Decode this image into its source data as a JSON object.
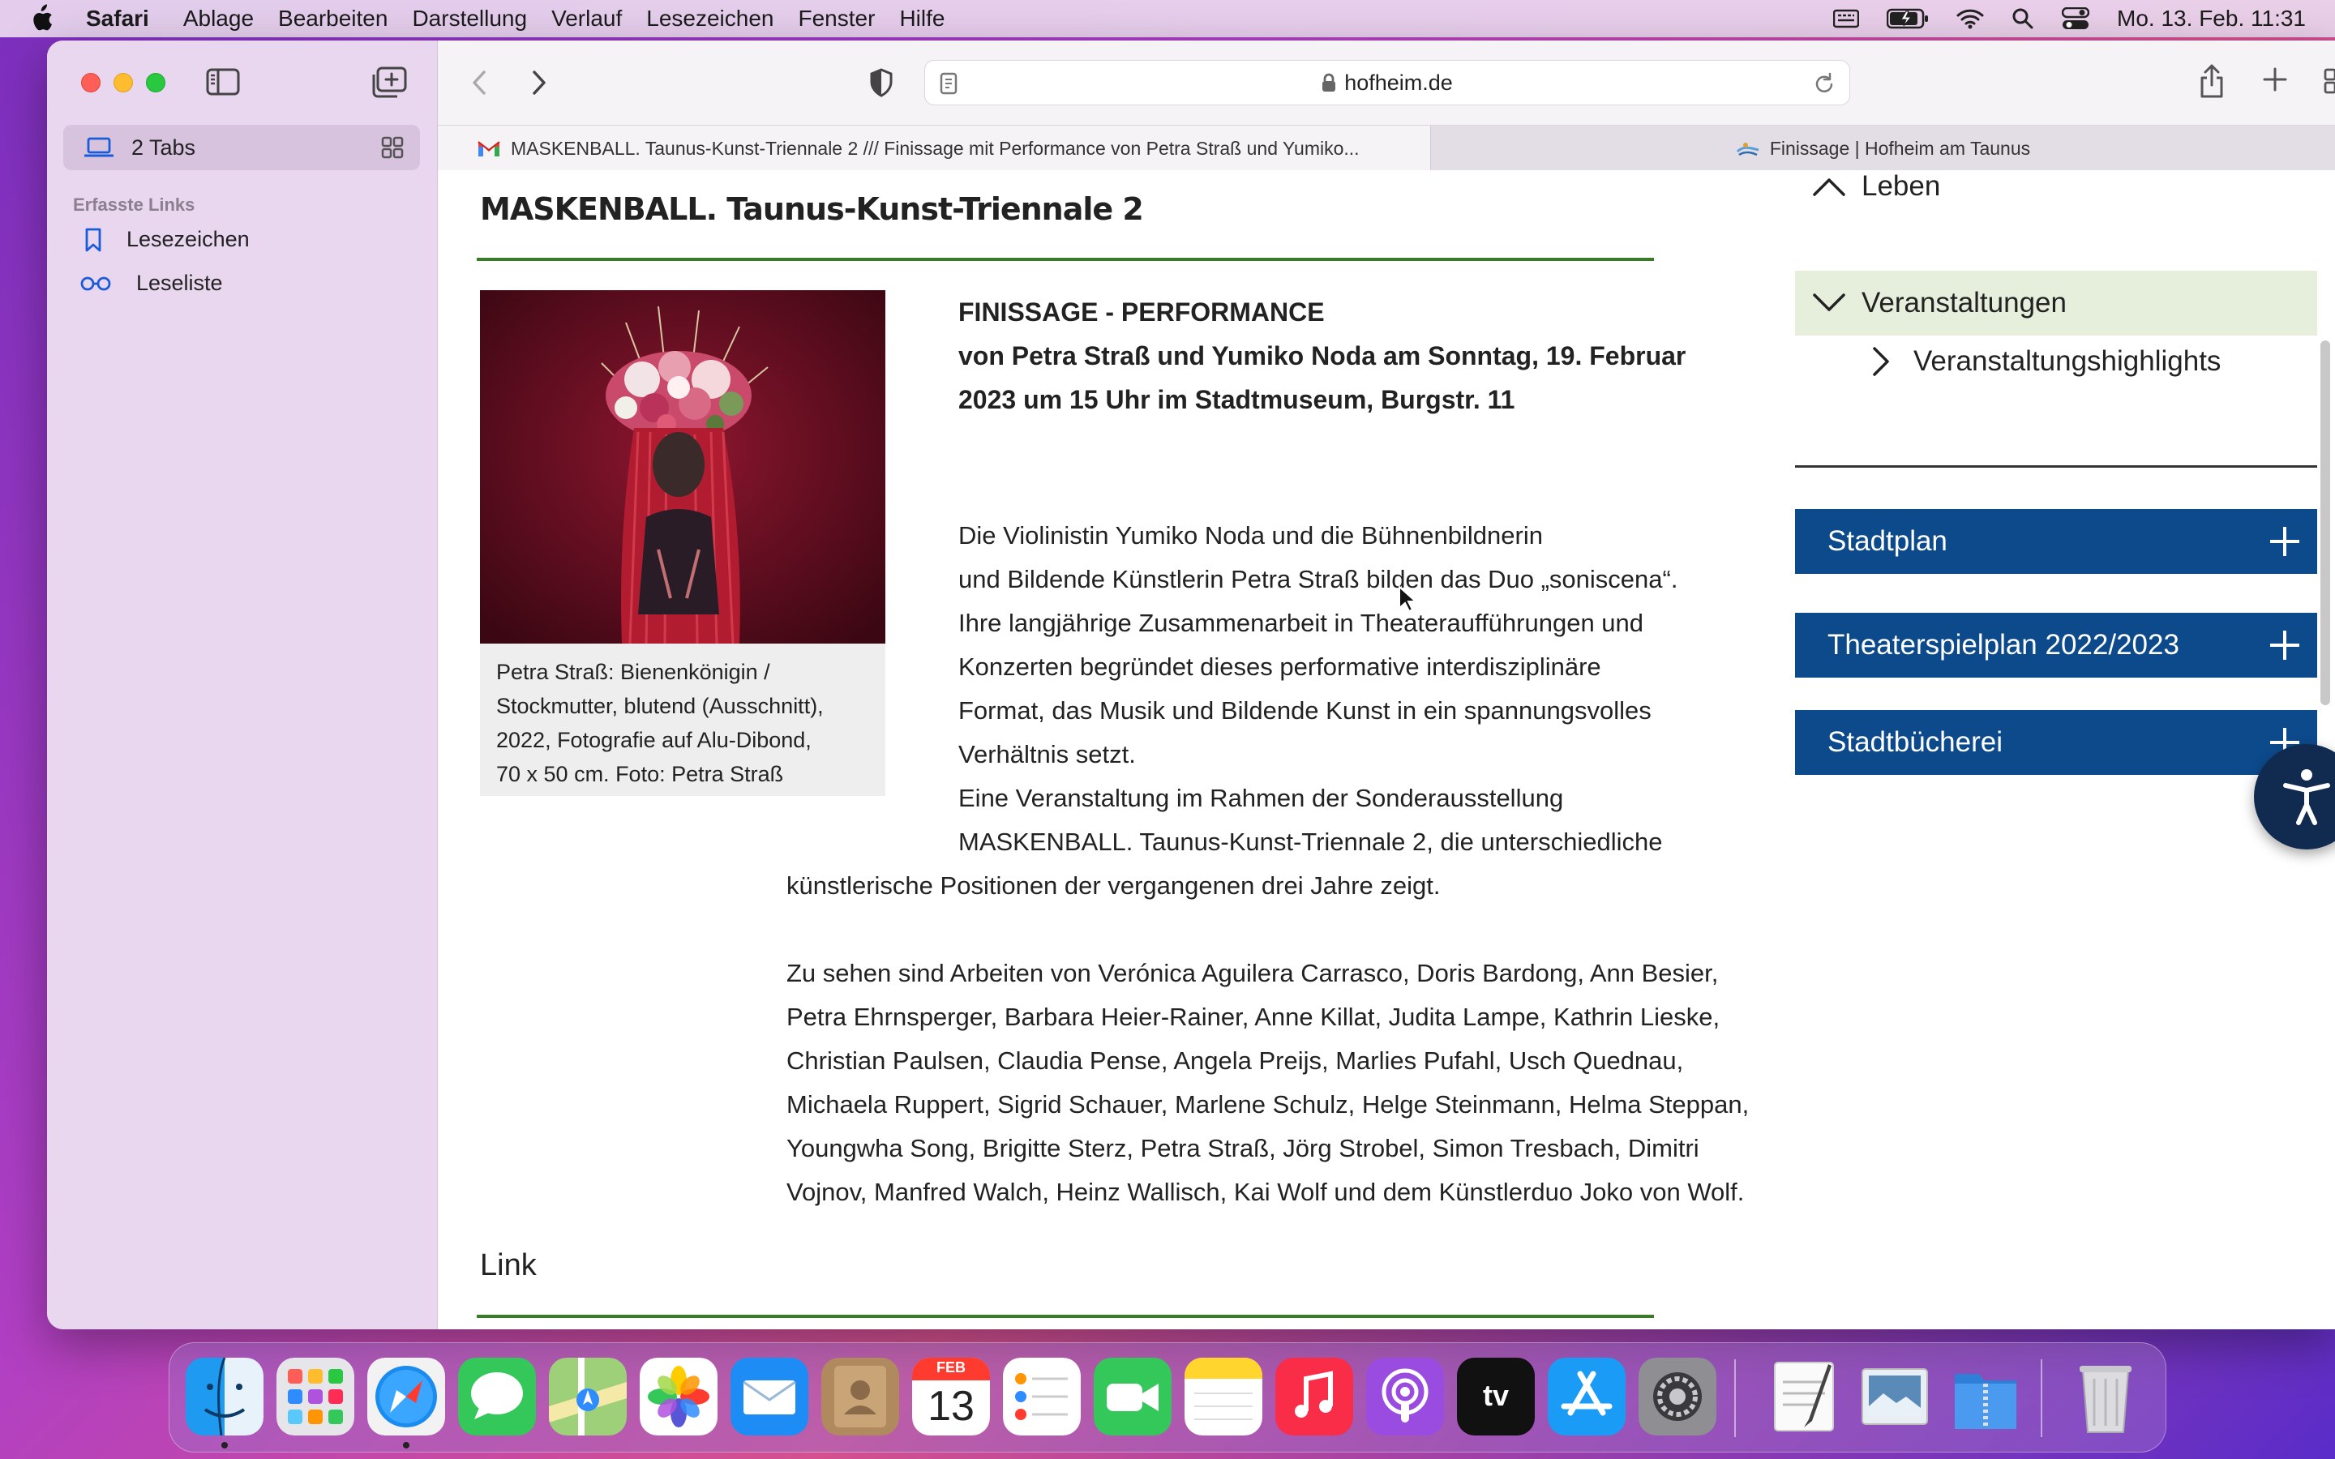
{
  "menubar": {
    "app_name": "Safari",
    "items": [
      "Ablage",
      "Bearbeiten",
      "Darstellung",
      "Verlauf",
      "Lesezeichen",
      "Fenster",
      "Hilfe"
    ],
    "clock": "Mo. 13. Feb.  11:31",
    "status_icons": [
      "keyboard-icon",
      "battery-icon",
      "wifi-icon",
      "search-icon",
      "control-center-icon"
    ]
  },
  "sidebar": {
    "tabs_label": "2 Tabs",
    "section_title": "Erfasste Links",
    "links": [
      {
        "label": "Lesezeichen",
        "icon": "bookmark-icon"
      },
      {
        "label": "Leseliste",
        "icon": "reading-list-icon"
      }
    ]
  },
  "toolbar": {
    "url": "hofheim.de"
  },
  "tabs": [
    {
      "title": "MASKENBALL. Taunus-Kunst-Triennale 2 /// Finissage mit Performance von Petra Straß und Yumiko...",
      "favicon": "gmail-icon",
      "active": true
    },
    {
      "title": "Finissage | Hofheim am Taunus",
      "favicon": "hofheim-icon",
      "active": false
    }
  ],
  "article": {
    "heading": "MASKENBALL. Taunus-Kunst-Triennale 2",
    "caption_lines": [
      "Petra Straß: Bienenkönigin /",
      "Stockmutter, blutend (Ausschnitt),",
      "2022, Fotografie auf Alu-Dibond,",
      "70 x 50 cm. Foto: Petra Straß"
    ],
    "event_title": "FINISSAGE - PERFORMANCE",
    "event_lines": [
      "von Petra Straß und Yumiko Noda am Sonntag, 19. Februar",
      "2023 um 15 Uhr im Stadtmuseum, Burgstr. 11"
    ],
    "para1_lines": [
      "Die Violinistin Yumiko Noda und die Bühnenbildnerin",
      "und Bildende Künstlerin Petra Straß bilden das Duo „soniscena“.",
      "Ihre langjährige Zusammenarbeit in Theateraufführungen und",
      "Konzerten begründet dieses performative interdisziplinäre",
      "Format, das Musik und Bildende Kunst in ein spannungsvolles",
      "Verhältnis setzt."
    ],
    "para2_lines": [
      "Eine Veranstaltung im Rahmen der Sonderausstellung",
      "MASKENBALL. Taunus-Kunst-Triennale 2, die unterschiedliche"
    ],
    "para2_cont": "künstlerische Positionen der vergangenen drei Jahre zeigt.",
    "para3_lines": [
      "Zu sehen sind Arbeiten von Verónica Aguilera Carrasco, Doris Bardong, Ann Besier,",
      "Petra Ehrnsperger, Barbara Heier-Rainer, Anne Killat, Judita Lampe, Kathrin Lieske,",
      "Christian Paulsen, Claudia Pense, Angela Preijs, Marlies Pufahl, Usch Quednau,",
      "Michaela Ruppert, Sigrid Schauer, Marlene Schulz, Helge Steinmann, Helma Steppan,",
      "Youngwha Song, Brigitte Sterz, Petra Straß, Jörg Strobel, Simon Tresbach, Dimitri",
      "Vojnov, Manfred Walch, Heinz Wallisch, Kai Wolf und dem Künstlerduo Joko von Wolf."
    ],
    "link_heading": "Link"
  },
  "rightnav": {
    "leben": "Leben",
    "veranstaltungen": "Veranstaltungen",
    "highlights": "Veranstaltungshighlights",
    "boxes": [
      "Stadtplan",
      "Theaterspielplan 2022/2023",
      "Stadtbücherei"
    ]
  },
  "dock": {
    "apps": [
      "finder-icon",
      "launchpad-icon",
      "safari-icon",
      "messages-icon",
      "maps-icon",
      "photos-icon",
      "mail-icon",
      "contacts-icon",
      "calendar-icon",
      "reminders-icon",
      "facetime-icon",
      "notes-icon",
      "music-icon",
      "podcasts-icon",
      "appletv-icon",
      "appstore-icon",
      "settings-icon",
      "textedit-icon",
      "preview-icon",
      "archive-icon",
      "trash-icon"
    ],
    "calendar_month": "FEB",
    "calendar_day": "13",
    "tv_label": "tv"
  }
}
